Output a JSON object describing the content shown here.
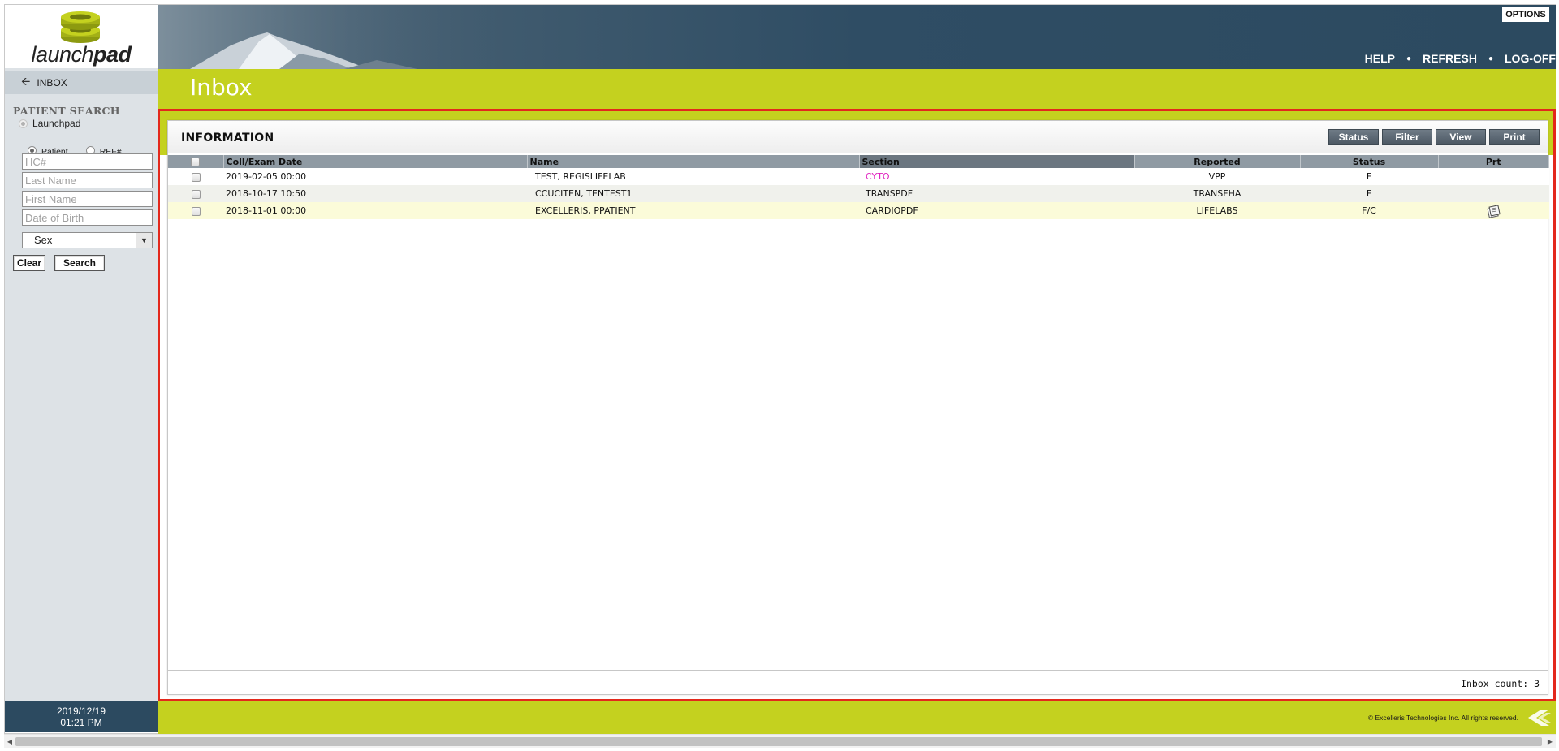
{
  "app": {
    "logo_text_light": "launch",
    "logo_text_bold": "pad"
  },
  "sidebar": {
    "nav_inbox": "INBOX",
    "patient_search_title": "PATIENT SEARCH",
    "source_option": "Launchpad",
    "type_options": [
      "Patient",
      "REF#"
    ],
    "fields": {
      "hc_placeholder": "HC#",
      "last_name_placeholder": "Last Name",
      "first_name_placeholder": "First Name",
      "dob_placeholder": "Date of Birth",
      "sex_selected": "Sex"
    },
    "clear_label": "Clear",
    "search_label": "Search",
    "date": "2019/12/19",
    "time": "01:21 PM"
  },
  "header": {
    "options_label": "OPTIONS",
    "nav": [
      "HELP",
      "REFRESH",
      "LOG-OFF"
    ]
  },
  "page": {
    "title": "Inbox"
  },
  "panel": {
    "title": "INFORMATION",
    "actions": [
      "Status",
      "Filter",
      "View",
      "Print"
    ],
    "columns": [
      "Coll/Exam Date",
      "Name",
      "Section",
      "Reported",
      "Status",
      "Prt"
    ],
    "rows": [
      {
        "date": "2019-02-05 00:00",
        "name": "TEST, REGISLIFELAB",
        "section": "CYTO",
        "reported": "VPP",
        "status": "F",
        "has_print": false
      },
      {
        "date": "2018-10-17 10:50",
        "name": "CCUCITEN, TENTEST1",
        "section": "TRANSPDF",
        "reported": "TRANSFHA",
        "status": "F",
        "has_print": false
      },
      {
        "date": "2018-11-01 00:00",
        "name": "EXCELLERIS, PPATIENT",
        "section": "CARDIOPDF",
        "reported": "LIFELABS",
        "status": "F/C",
        "has_print": true
      }
    ],
    "inbox_count": "Inbox count: 3"
  },
  "footer": {
    "copyright": "© Excelleris Technologies Inc. All rights reserved."
  },
  "colors": {
    "lime": "#c4d11f",
    "navy": "#2c4a60",
    "alert_red": "#e3281c",
    "cyto_pink": "#e020c0"
  }
}
